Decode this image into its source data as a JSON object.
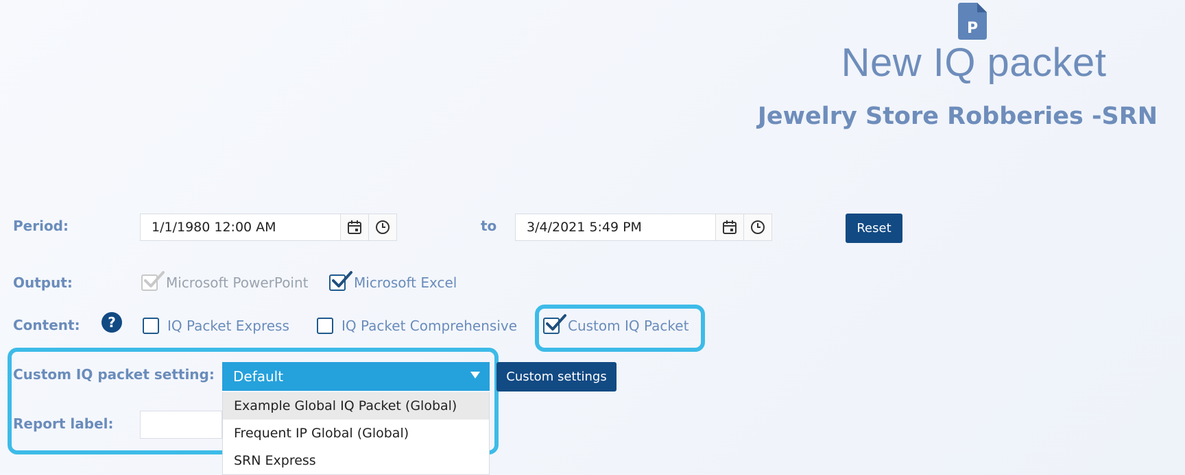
{
  "header": {
    "icon": "document-p-icon",
    "icon_letter": "P",
    "title": "New IQ packet",
    "subtitle": "Jewelry Store Robberies -SRN"
  },
  "period": {
    "label": "Period:",
    "from_value": "1/1/1980 12:00 AM",
    "to_label": "to",
    "to_value": "3/4/2021 5:49 PM",
    "reset_label": "Reset"
  },
  "output": {
    "label": "Output:",
    "options": [
      {
        "label": "Microsoft PowerPoint",
        "checked": true,
        "disabled": true
      },
      {
        "label": "Microsoft Excel",
        "checked": true,
        "disabled": false
      }
    ]
  },
  "content": {
    "label": "Content:",
    "help_text": "?",
    "options": [
      {
        "label": "IQ Packet Express",
        "checked": false
      },
      {
        "label": "IQ Packet Comprehensive",
        "checked": false
      },
      {
        "label": "Custom IQ Packet",
        "checked": true
      }
    ]
  },
  "custom_setting": {
    "label": "Custom IQ packet setting:",
    "selected": "Default",
    "options": [
      "Example Global IQ Packet (Global)",
      "Frequent IP Global (Global)",
      "SRN Express"
    ],
    "custom_settings_label": "Custom settings"
  },
  "report_label": {
    "label": "Report label:",
    "value": ""
  },
  "colors": {
    "accent": "#25a1dc",
    "primary_button": "#124a83",
    "highlight": "#3dbbe8",
    "label_text": "#6a8cbb"
  }
}
